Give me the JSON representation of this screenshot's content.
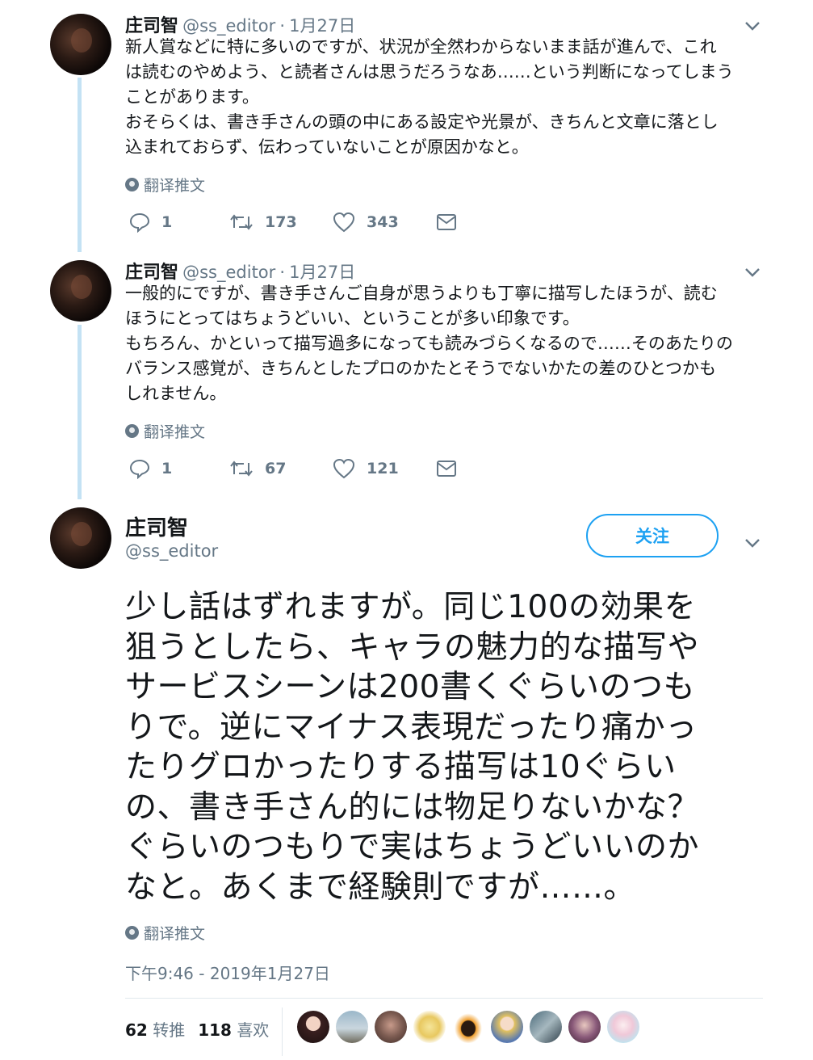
{
  "tweets": [
    {
      "name": "庄司智",
      "handle": "@ss_editor",
      "date": "1月27日",
      "lines": [
        "新人賞などに特に多いのですが、状況が全然わからないまま話が進んで、これ",
        "は読むのやめよう、と読者さんは思うだろうなあ……という判断になってしまう",
        "ことがあります。",
        "おそらくは、書き手さんの頭の中にある設定や光景が、きちんと文章に落とし",
        "込まれておらず、伝わっていないことが原因かなと。"
      ],
      "translate": "翻译推文",
      "replies": "1",
      "retweets": "173",
      "likes": "343"
    },
    {
      "name": "庄司智",
      "handle": "@ss_editor",
      "date": "1月27日",
      "lines": [
        "一般的にですが、書き手さんご自身が思うよりも丁寧に描写したほうが、読む",
        "ほうにとってはちょうどいい、ということが多い印象です。",
        "もちろん、かといって描写過多になっても読みづらくなるので……そのあたりの",
        "バランス感覚が、きちんとしたプロのかたとそうでないかたの差のひとつかも",
        "しれません。"
      ],
      "translate": "翻译推文",
      "replies": "1",
      "retweets": "67",
      "likes": "121"
    }
  ],
  "main": {
    "name": "庄司智",
    "handle": "@ss_editor",
    "follow_label": "关注",
    "lines": [
      "少し話はずれますが。同じ100の効果を",
      "狙うとしたら、キャラの魅力的な描写や",
      "サービスシーンは200書くぐらいのつも",
      "りで。逆にマイナス表現だったり痛かっ",
      "たりグロかったりする描写は10ぐらい",
      "の、書き手さん的には物足りないかな？",
      "ぐらいのつもりで実はちょうどいいのか",
      "なと。あくまで経験則ですが……。"
    ],
    "translate": "翻译推文",
    "timestamp": "下午9:46 - 2019年1月27日",
    "retweet_count": "62",
    "retweet_label": "转推",
    "like_count": "118",
    "like_label": "喜欢"
  },
  "colors": {
    "accent": "#1da1f2",
    "thread_line": "#c4e2f4",
    "secondary_text": "#657786"
  }
}
